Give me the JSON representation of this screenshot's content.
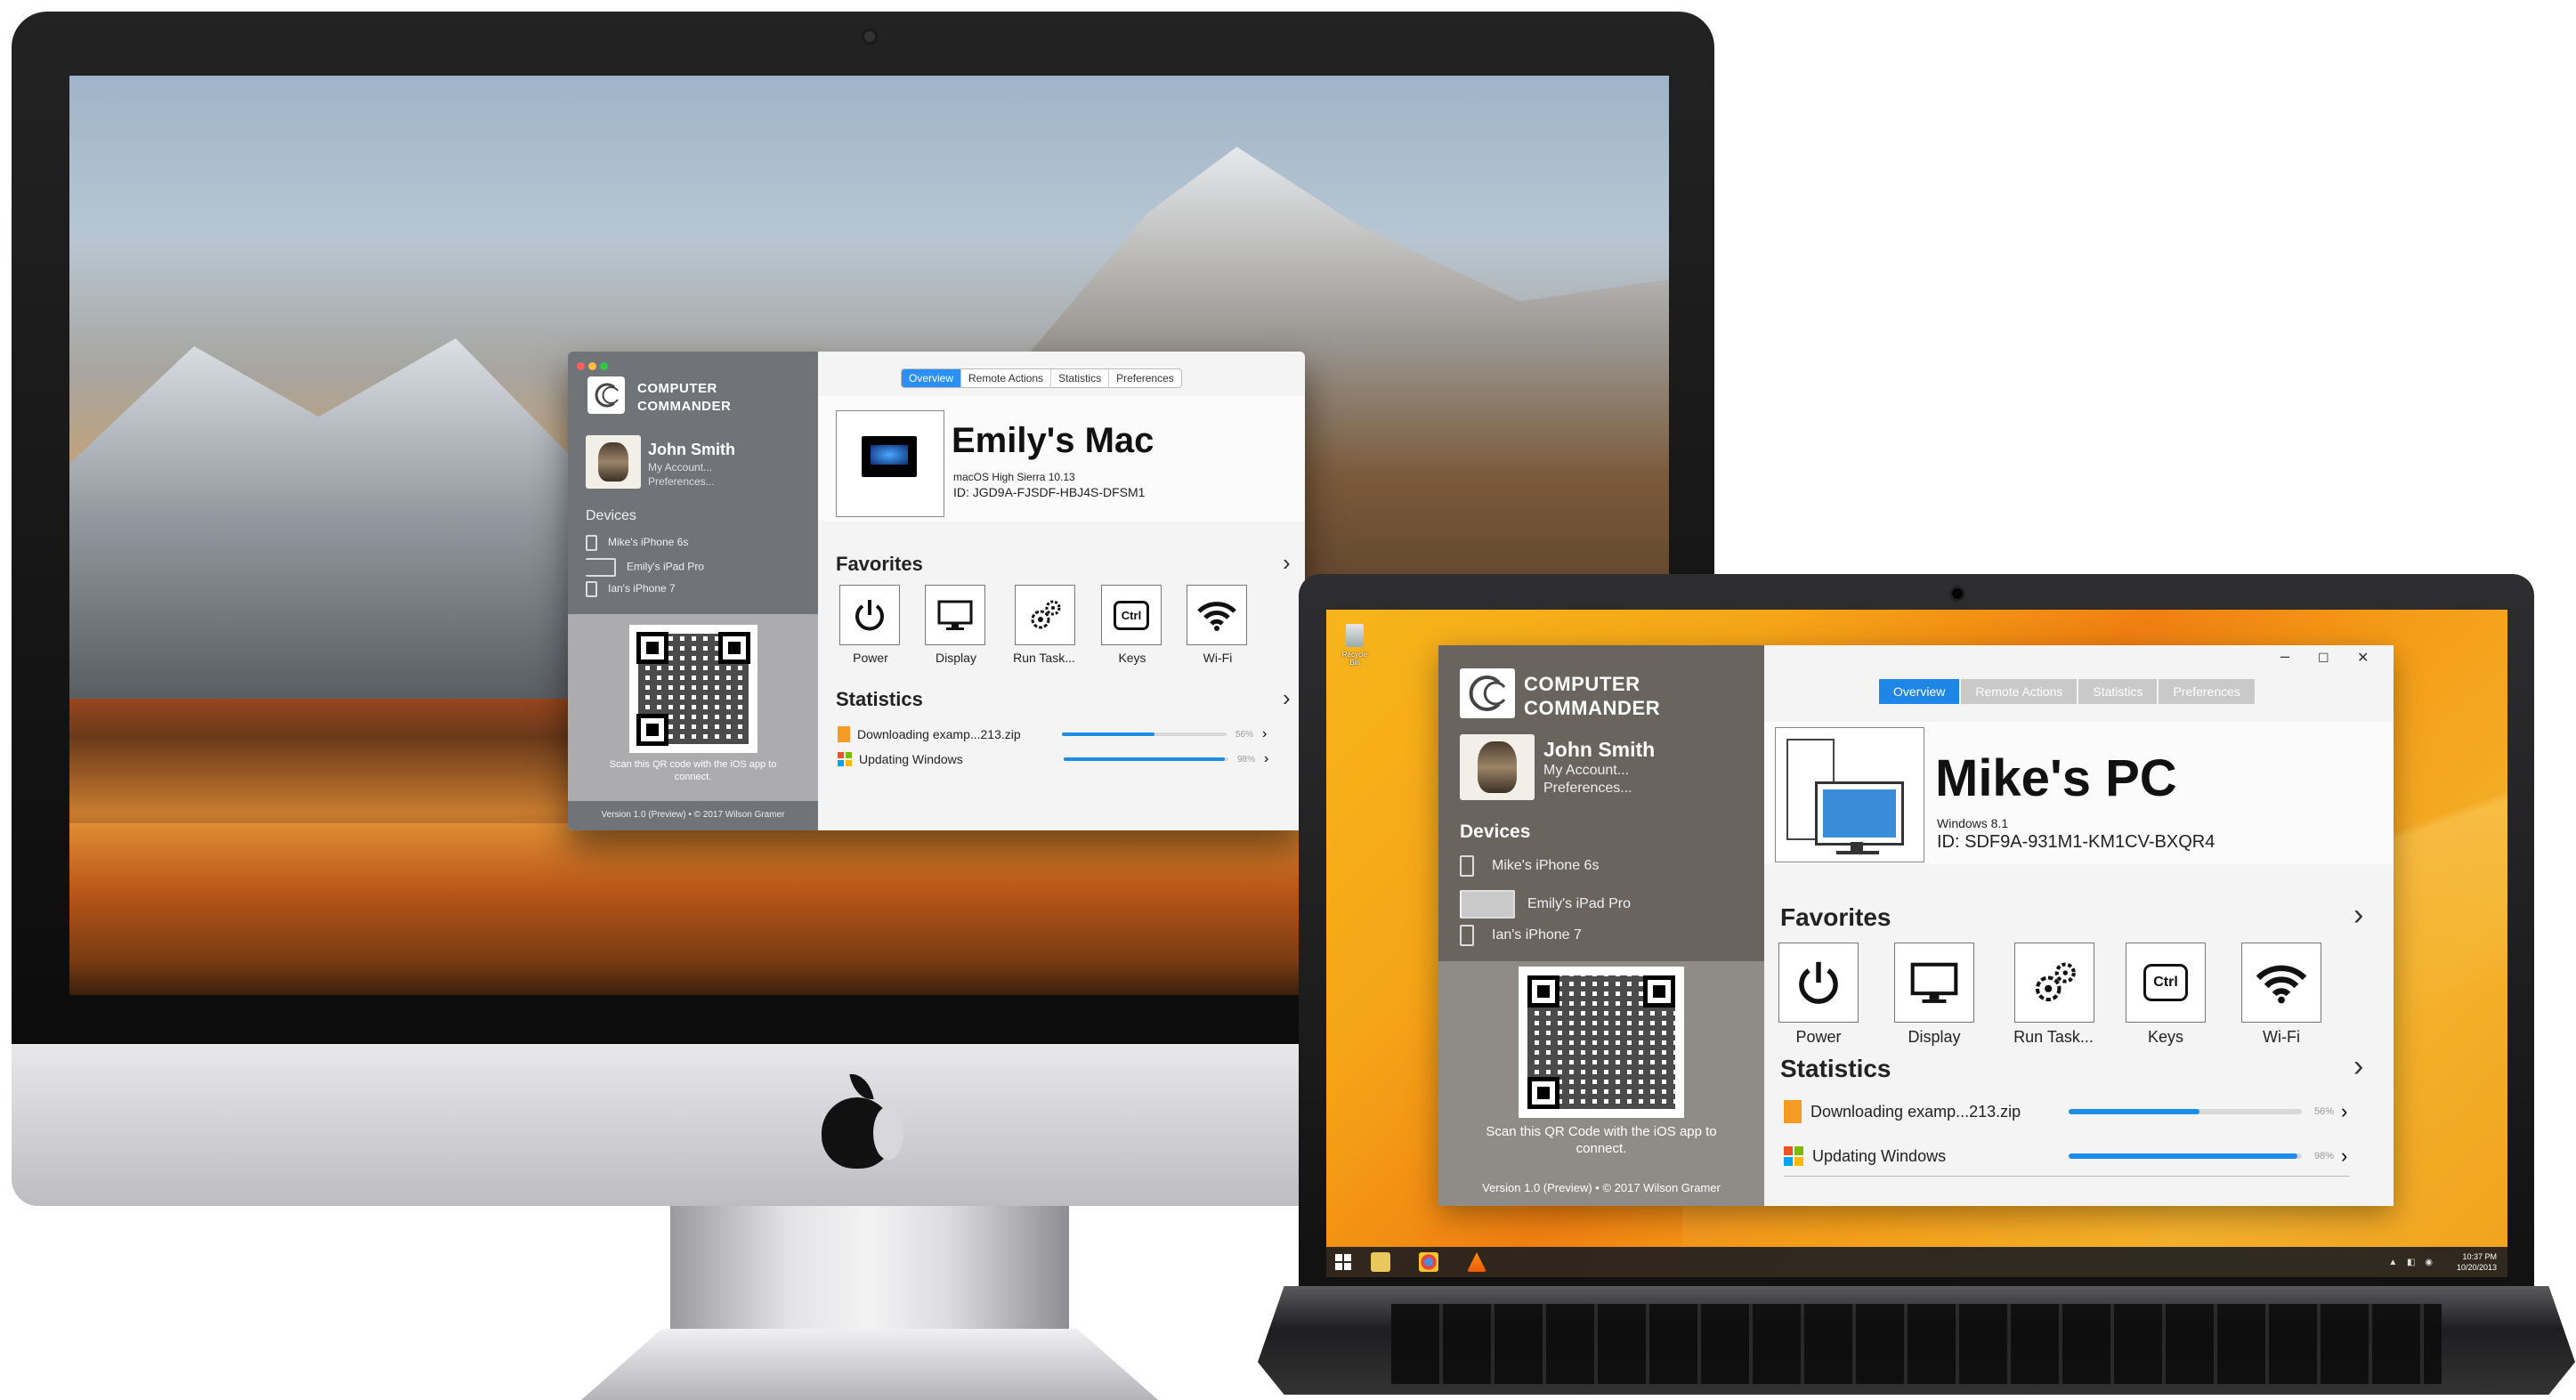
{
  "mac": {
    "window": {
      "brand_line1": "COMPUTER",
      "brand_line2": "COMMANDER",
      "user": {
        "name": "John Smith",
        "link1": "My Account...",
        "link2": "Preferences..."
      },
      "devices_title": "Devices",
      "devices": [
        "Mike's iPhone 6s",
        "Emily's iPad Pro",
        "Ian's iPhone 7"
      ],
      "qr_text": "Scan this QR code with the iOS app to connect.",
      "version": "Version 1.0 (Preview) • © 2017 Wilson Gramer",
      "tabs": [
        "Overview",
        "Remote Actions",
        "Statistics",
        "Preferences"
      ],
      "active_tab": "Overview",
      "device": {
        "name": "Emily's Mac",
        "os": "macOS High Sierra 10.13",
        "id": "ID: JGD9A-FJSDF-HBJ4S-DFSM1"
      },
      "favorites_title": "Favorites",
      "favorites": [
        "Power",
        "Display",
        "Run Task...",
        "Keys",
        "Wi-Fi"
      ],
      "keys_glyph": "Ctrl",
      "statistics_title": "Statistics",
      "stats": [
        {
          "label": "Downloading examp...213.zip",
          "percent": "56%",
          "progress": 0.56,
          "icon": "zip-file-icon"
        },
        {
          "label": "Updating Windows",
          "percent": "98%",
          "progress": 0.98,
          "icon": "windows-logo-icon"
        }
      ],
      "chevron": "›"
    }
  },
  "pc": {
    "desktop": {
      "recycle_bin": "Recycle Bin"
    },
    "taskbar": {
      "time": "10:37 PM",
      "date": "10/20/2013"
    },
    "window": {
      "brand_line1": "COMPUTER",
      "brand_line2": "COMMANDER",
      "user": {
        "name": "John Smith",
        "link1": "My Account...",
        "link2": "Preferences..."
      },
      "devices_title": "Devices",
      "devices": [
        "Mike's iPhone 6s",
        "Emily's iPad Pro",
        "Ian's iPhone 7"
      ],
      "qr_text": "Scan this QR Code with the iOS app to connect.",
      "version": "Version 1.0 (Preview) • © 2017 Wilson Gramer",
      "controls": {
        "minimize": "–",
        "maximize": "☐",
        "close": "✕"
      },
      "tabs": [
        "Overview",
        "Remote Actions",
        "Statistics",
        "Preferences"
      ],
      "active_tab": "Overview",
      "device": {
        "name": "Mike's PC",
        "os": "Windows 8.1",
        "id": "ID: SDF9A-931M1-KM1CV-BXQR4"
      },
      "favorites_title": "Favorites",
      "favorites": [
        "Power",
        "Display",
        "Run Task...",
        "Keys",
        "Wi-Fi"
      ],
      "keys_glyph": "Ctrl",
      "statistics_title": "Statistics",
      "stats": [
        {
          "label": "Downloading examp...213.zip",
          "percent": "56%",
          "progress": 0.56,
          "icon": "zip-file-icon"
        },
        {
          "label": "Updating Windows",
          "percent": "98%",
          "progress": 0.98,
          "icon": "windows-logo-icon"
        }
      ],
      "chevron": "›"
    }
  },
  "colors": {
    "accent_blue": "#1d86e6",
    "sidebar_mac": "#64686e",
    "sidebar_win": "#69645d"
  }
}
